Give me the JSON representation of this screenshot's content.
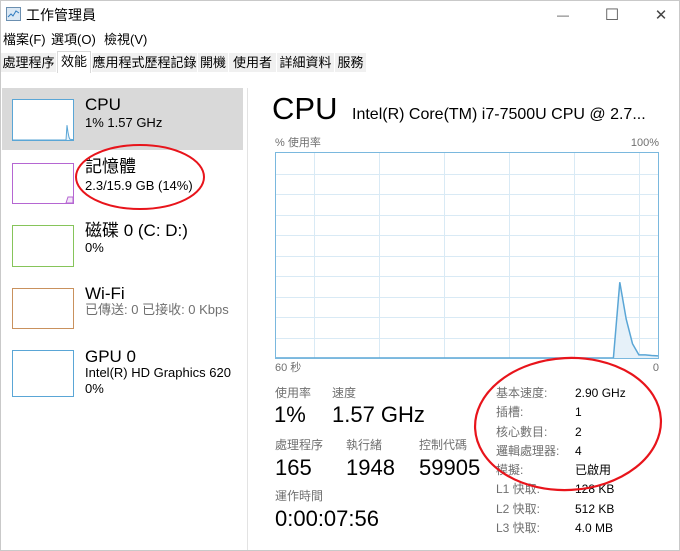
{
  "window": {
    "title": "工作管理員",
    "controls": {
      "minimize": "—",
      "maximize": "☐",
      "close": "✕"
    }
  },
  "menu": [
    "檔案(F)",
    "選項(O)",
    "檢視(V)"
  ],
  "tabs": [
    {
      "label": "處理程序",
      "active": false
    },
    {
      "label": "效能",
      "active": true
    },
    {
      "label": "應用程式歷程記錄",
      "active": false
    },
    {
      "label": "開機",
      "active": false
    },
    {
      "label": "使用者",
      "active": false
    },
    {
      "label": "詳細資料",
      "active": false
    },
    {
      "label": "服務",
      "active": false
    }
  ],
  "sidebar": {
    "selected": "CPU",
    "items": [
      {
        "title": "CPU",
        "line1": "1% 1.57 GHz",
        "color": "#5aa6d6"
      },
      {
        "title": "記憶體",
        "line1": "2.3/15.9 GB (14%)",
        "color": "#b566d2"
      },
      {
        "title": "磁碟 0 (C: D:)",
        "line1": "0%",
        "color": "#86c45a"
      },
      {
        "title": "Wi-Fi",
        "line1": "已傳送: 0 已接收: 0 Kbps",
        "color": "#c9915d"
      },
      {
        "title": "GPU 0",
        "line1": "Intel(R) HD Graphics 620",
        "line2": "0%",
        "color": "#5aa6d6"
      }
    ]
  },
  "main": {
    "title": "CPU",
    "cpu_name": "Intel(R) Core(TM) i7-7500U CPU @ 2.7...",
    "stats": {
      "usage": {
        "label": "使用率",
        "value": "1%"
      },
      "speed": {
        "label": "速度",
        "value": "1.57 GHz"
      },
      "processes": {
        "label": "處理程序",
        "value": "165"
      },
      "threads": {
        "label": "執行緒",
        "value": "1948"
      },
      "handles": {
        "label": "控制代碼",
        "value": "59905"
      },
      "uptime": {
        "label": "運作時間",
        "value": "0:00:07:56"
      }
    },
    "details": [
      {
        "label": "基本速度:",
        "value": "2.90 GHz"
      },
      {
        "label": "插槽:",
        "value": "1"
      },
      {
        "label": "核心數目:",
        "value": "2"
      },
      {
        "label": "邏輯處理器:",
        "value": "4"
      },
      {
        "label": "模擬:",
        "value": "已啟用"
      },
      {
        "label": "L1 快取:",
        "value": "128 KB"
      },
      {
        "label": "L2 快取:",
        "value": "512 KB"
      },
      {
        "label": "L3 快取:",
        "value": "4.0 MB"
      }
    ]
  },
  "annotations": {
    "color": "#e8141b",
    "highlighted": [
      "memory-summary",
      "cpu-details"
    ]
  },
  "chart_data": {
    "type": "area",
    "title": "CPU",
    "ylabel": "% 使用率",
    "ymax_label": "100%",
    "xlabel_left": "60 秒",
    "xlabel_right": "0",
    "ylim": [
      0,
      100
    ],
    "xlim_seconds": [
      60,
      0
    ],
    "grid": true,
    "line_color": "#5aa6d6",
    "fill_color": "#e6f1f9",
    "x_seconds_ago": [
      60,
      59,
      58,
      57,
      56,
      55,
      54,
      53,
      52,
      51,
      50,
      49,
      48,
      47,
      46,
      45,
      44,
      43,
      42,
      41,
      40,
      39,
      38,
      37,
      36,
      35,
      34,
      33,
      32,
      31,
      30,
      29,
      28,
      27,
      26,
      25,
      24,
      23,
      22,
      21,
      20,
      19,
      18,
      17,
      16,
      15,
      14,
      13,
      12,
      11,
      10,
      9,
      8,
      7,
      6,
      5,
      4,
      3,
      2,
      1,
      0
    ],
    "values": [
      0,
      0,
      0,
      0,
      0,
      0,
      0,
      0,
      0,
      0,
      0,
      0,
      0,
      0,
      0,
      0,
      0,
      0,
      0,
      0,
      0,
      0,
      0,
      0,
      0,
      0,
      0,
      0,
      0,
      0,
      0,
      0,
      0,
      0,
      0,
      0,
      0,
      0,
      0,
      0,
      0,
      0,
      0,
      0,
      0,
      0,
      0,
      0,
      0,
      0,
      0,
      0,
      0,
      0,
      37,
      19,
      7,
      1.5,
      1.5,
      1.2,
      1
    ]
  }
}
